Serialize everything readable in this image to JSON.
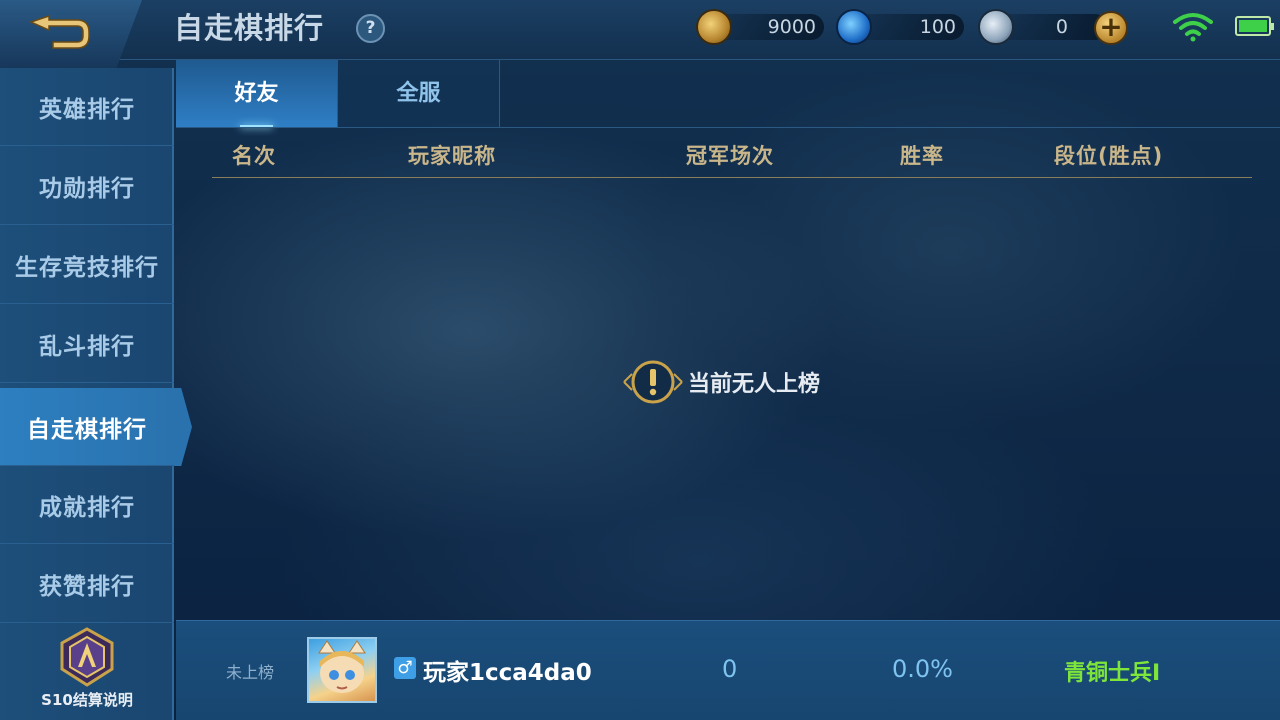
{
  "header": {
    "title": "自走棋排行",
    "help_icon": "?",
    "currencies": [
      {
        "icon": "gold-coin-icon",
        "value": "9000"
      },
      {
        "icon": "diamond-icon",
        "value": "100"
      },
      {
        "icon": "voucher-icon",
        "value": "0"
      }
    ],
    "add_icon": "+"
  },
  "sidebar": {
    "items": [
      {
        "label": "英雄排行",
        "active": false
      },
      {
        "label": "功勋排行",
        "active": false
      },
      {
        "label": "生存竞技排行",
        "active": false
      },
      {
        "label": "乱斗排行",
        "active": false
      },
      {
        "label": "自走棋排行",
        "active": true
      },
      {
        "label": "成就排行",
        "active": false
      },
      {
        "label": "获赞排行",
        "active": false
      }
    ],
    "season_label": "S10结算说明"
  },
  "tabs": [
    {
      "label": "好友",
      "active": true
    },
    {
      "label": "全服",
      "active": false
    }
  ],
  "table": {
    "columns": [
      "名次",
      "玩家昵称",
      "冠军场次",
      "胜率",
      "段位(胜点)"
    ],
    "empty_message": "当前无人上榜"
  },
  "self_row": {
    "rank_status": "未上榜",
    "gender_symbol": "♂",
    "player_name": "玩家1cca4da0",
    "championships": "0",
    "win_rate": "0.0%",
    "tier": "青铜士兵Ⅰ"
  },
  "colors": {
    "accent_blue": "#2a72ae",
    "header_gold": "#c9b68a",
    "tier_green": "#7ee63a"
  }
}
